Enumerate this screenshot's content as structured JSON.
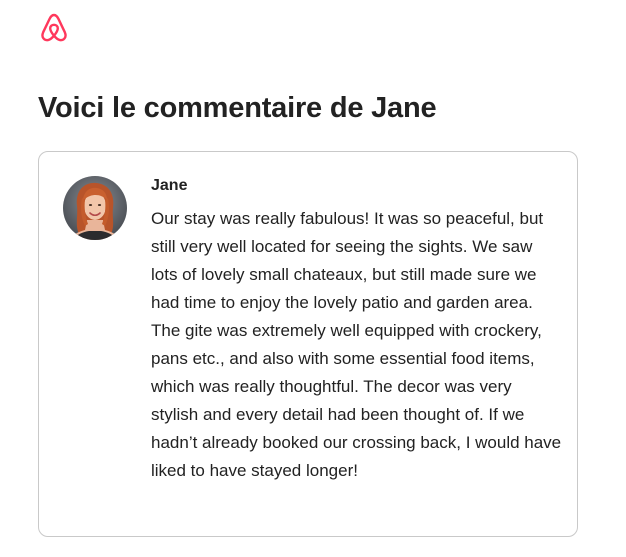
{
  "app": {
    "logo_icon": "airbnb-logo-icon",
    "brand_color": "#FF385C"
  },
  "page": {
    "title": "Voici le commentaire de Jane"
  },
  "review": {
    "reviewer_name": "Jane",
    "avatar_icon": "user-avatar",
    "text": "Our stay was really fabulous! It was so peaceful, but still very well located for seeing the sights. We saw lots of lovely small chateaux, but still made sure we had time to enjoy the lovely patio and garden area. The gite was extremely well equipped with crockery, pans etc., and also with some essential food items, which was really thoughtful. The decor was very stylish and every detail had been thought of. If we hadn’t already booked our crossing back, I would have liked to have stayed longer!"
  }
}
